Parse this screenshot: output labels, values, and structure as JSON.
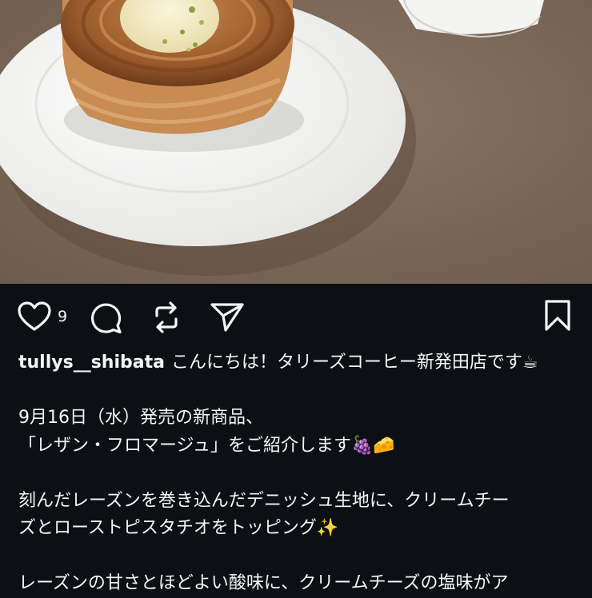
{
  "post": {
    "image_alt": "Raisin fromage danish pastry on a white plate",
    "like_count": "9",
    "username": "tullys__shibata",
    "caption_lines": [
      "こんにちは！タリーズコーヒー新発田店です☕",
      "9月16日（水）発売の新商品、",
      "「レザン・フロマージュ」をご紹介します🍇🧀",
      "刻んだレーズンを巻き込んだデニッシュ生地に、クリームチー",
      "ズとローストピスタチオをトッピング✨",
      "レーズンの甘さとほどよい酸味に、クリームチーズの塩味がア"
    ]
  },
  "icons": {
    "like": "heart-icon",
    "comment": "comment-bubble-icon",
    "repost": "repost-icon",
    "share": "send-icon",
    "save": "bookmark-icon"
  },
  "colors": {
    "background": "#0c1014",
    "text": "#f5f5f5",
    "table": "#7b6755",
    "plate": "#f2f2f0",
    "pastry": "#a8683a"
  }
}
